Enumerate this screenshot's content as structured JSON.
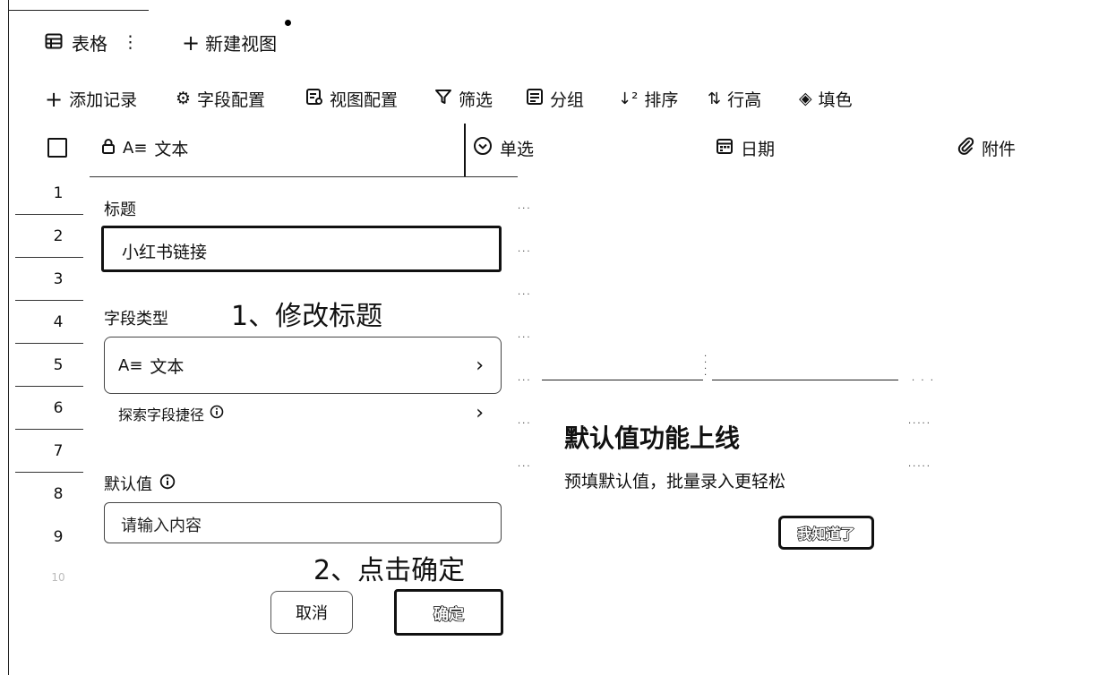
{
  "view_bar": {
    "table_tab_label": "表格",
    "new_view_label": "新建视图"
  },
  "toolbar": {
    "add_record": "添加记录",
    "field_config": "字段配置",
    "view_config": "视图配置",
    "filter": "筛选",
    "group": "分组",
    "sort": "排序",
    "row_height": "行高",
    "fill_color": "填色"
  },
  "columns": {
    "text": "文本",
    "single_select": "单选",
    "date": "日期",
    "attachment": "附件"
  },
  "rows": [
    "1",
    "2",
    "3",
    "4",
    "5",
    "6",
    "7",
    "8",
    "9",
    "10"
  ],
  "field_editor": {
    "title_label": "标题",
    "title_value": "小红书链接",
    "field_type_label": "字段类型",
    "field_type_value": "文本",
    "explore_label": "探索字段捷径",
    "default_label": "默认值",
    "default_placeholder": "请输入内容",
    "cancel_label": "取消",
    "confirm_label": "确定"
  },
  "annotations": {
    "step1": "1、修改标题",
    "step2": "2、点击确定"
  },
  "popup": {
    "title": "默认值功能上线",
    "description": "预填默认值，批量录入更轻松",
    "button_label": "我知道了"
  },
  "icons": {
    "table": "table-icon",
    "more": "more-vertical-icon",
    "plus": "plus-icon",
    "gear": "gear-icon",
    "view_config": "view-config-icon",
    "filter": "filter-icon",
    "group": "group-icon",
    "sort": "sort-icon",
    "row_height": "row-height-icon",
    "fill": "fill-icon",
    "lock": "lock-icon",
    "text_type": "text-type-icon",
    "single_select": "single-select-icon",
    "calendar": "calendar-icon",
    "paperclip": "paperclip-icon",
    "chevron_right": "chevron-right-icon",
    "info": "info-icon"
  }
}
